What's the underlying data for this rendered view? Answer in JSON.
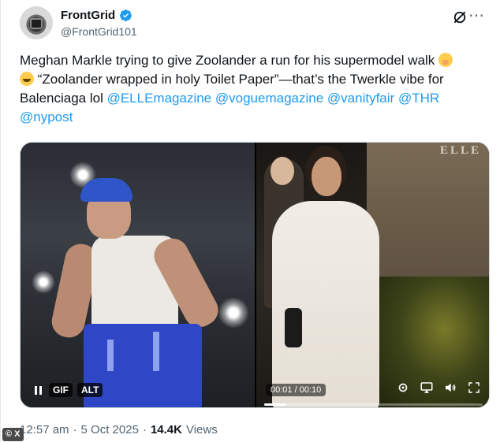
{
  "author": {
    "display_name": "FrontGrid",
    "handle": "@FrontGrid101",
    "verified": true,
    "avatar_icon": "camera-avatar-icon"
  },
  "tweet": {
    "line1_text": "Meghan Markle trying to give Zoolander a run for his supermodel walk ",
    "line2_text": " “Zoolander wrapped in holy Toilet Paper”—that’s the Twerkle vibe for",
    "line3_text": "Balenciaga lol ",
    "emoji1": "shushing-face-emoji",
    "emoji2": "rolling-on-floor-laughing-emoji",
    "mentions": [
      "@ELLEmagazine",
      "@voguemagazine",
      "@vanityfair",
      "@THR",
      "@nypost"
    ]
  },
  "media": {
    "left": {
      "pause_icon": "pause-icon",
      "gif_label": "GIF",
      "alt_label": "ALT"
    },
    "right": {
      "watermark": "ELLE",
      "time_display": "00:01 / 00:10",
      "progress_fraction": 0.1,
      "icons": [
        "settings-icon",
        "airplay-icon",
        "volume-icon",
        "fullscreen-icon"
      ]
    }
  },
  "meta": {
    "time": "12:57 am",
    "separator1": "·",
    "date": "5 Oct 2025",
    "separator2": "·",
    "views_count": "14.4K",
    "views_label": "Views"
  },
  "corner_badge": "© X",
  "colors": {
    "link": "#1d9bf0",
    "verified": "#1d9bf0",
    "text": "#0f1419",
    "secondary": "#536471"
  }
}
